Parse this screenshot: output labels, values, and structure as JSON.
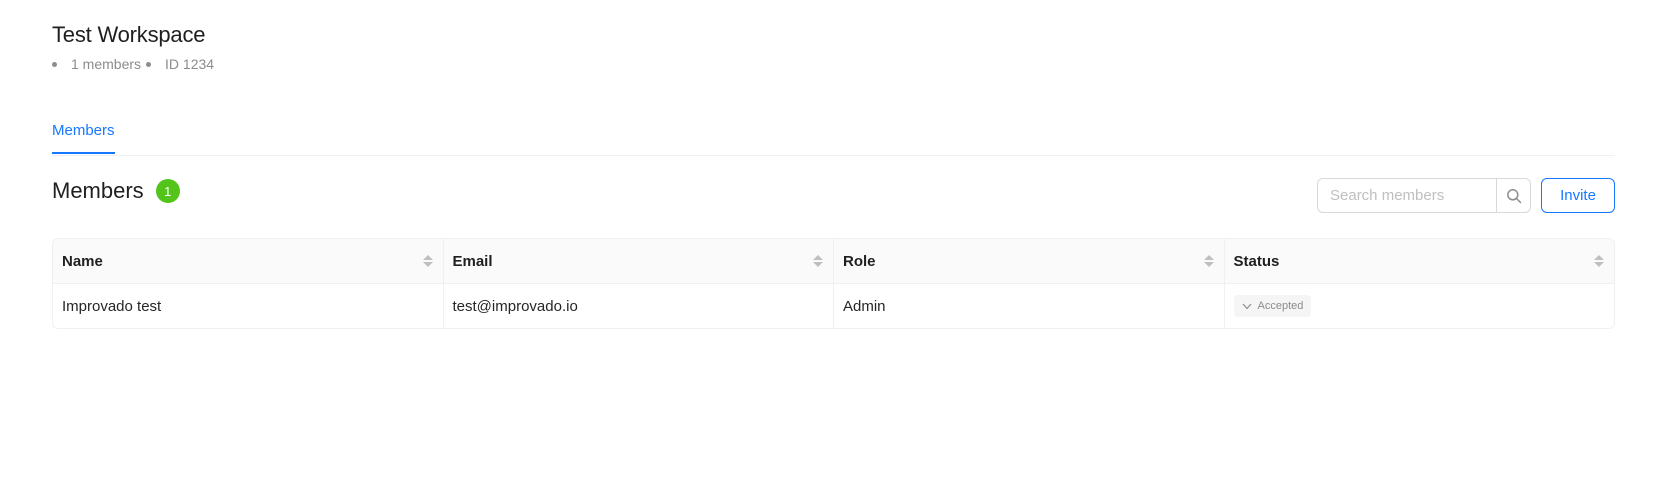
{
  "workspace": {
    "title": "Test Workspace",
    "members_count_text": "1 members",
    "id_text": "ID 1234"
  },
  "tabs": [
    {
      "label": "Members",
      "active": true
    }
  ],
  "section": {
    "title": "Members",
    "count": "1",
    "search_placeholder": "Search members",
    "invite_label": "Invite"
  },
  "table": {
    "columns": [
      "Name",
      "Email",
      "Role",
      "Status"
    ],
    "rows": [
      {
        "name": "Improvado test",
        "email": "test@improvado.io",
        "role": "Admin",
        "status": "Accepted"
      }
    ]
  },
  "icons": {
    "search": "search-icon",
    "status": "chevron-down-icon"
  },
  "colors": {
    "accent": "#1677ff",
    "badge": "#52c41a"
  }
}
